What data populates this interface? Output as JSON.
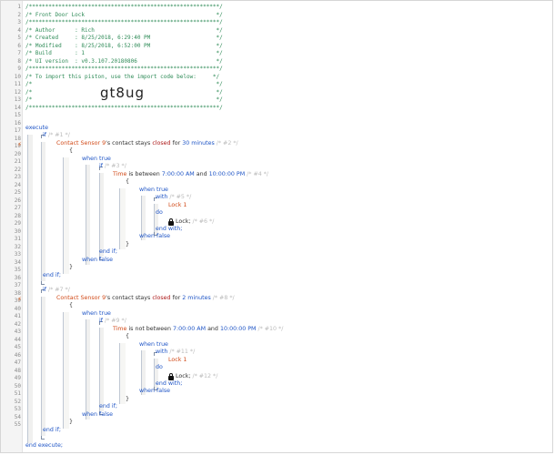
{
  "header": [
    "/**********************************************************/",
    "/* Front Door Lock                                        */",
    "/**********************************************************/",
    "/* Author      : Rich                                     */",
    "/* Created     : 8/25/2018, 6:29:40 PM                    */",
    "/* Modified    : 8/25/2018, 6:52:00 PM                    */",
    "/* Build       : 1                                        */",
    "/* UI version  : v0.3.107.20180806                        */",
    "/**********************************************************/",
    "/* To import this piston, use the import code below:     */",
    "/*                                                        */",
    "/*                                                        */",
    "/*                                                        */",
    "/**********************************************************/"
  ],
  "import_code": "gt8ug",
  "line_numbers": [
    "1",
    "2",
    "3",
    "4",
    "5",
    "6",
    "7",
    "8",
    "9",
    "10",
    "11",
    "12",
    "13",
    "14",
    "15",
    "16",
    "17",
    "18",
    "19",
    "20",
    "21",
    "22",
    "23",
    "24",
    "25",
    "26",
    "27",
    "28",
    "29",
    "30",
    "31",
    "32",
    "33",
    "34",
    "35",
    "36",
    "37",
    "38",
    "39",
    "40",
    "41",
    "42",
    "43",
    "44",
    "45",
    "46",
    "47",
    "48",
    "49",
    "50",
    "51",
    "52",
    "53",
    "54",
    "55"
  ],
  "trigger_mark": "⚡",
  "code": {
    "execute": "execute",
    "end_execute": "end execute;",
    "if_kw": "if",
    "end_if": "end if;",
    "brace_open": "{",
    "brace_close": "}",
    "when_true": "when true",
    "when_false": "when false",
    "with_kw": "with",
    "do_kw": "do",
    "end_with": "end with;",
    "blocks": [
      {
        "if_comment": "/* #1 */",
        "cond_device": "Contact Sensor 9",
        "cond_possessive": "'s contact",
        "cond_op": "stays",
        "cond_value": "closed",
        "cond_for": "for",
        "cond_duration": "30 minutes",
        "cond_comment": "/* #2 */",
        "inner_if_comment": "/* #3 */",
        "time_label": "Time",
        "time_op": "is between",
        "time_start": "7:00:00 AM",
        "time_and": "and",
        "time_end": "10:00:00 PM",
        "time_comment": "/* #4 */",
        "with_comment": "/* #5 */",
        "device": "Lock 1",
        "cmd": "Lock;",
        "cmd_comment": "/* #6 */"
      },
      {
        "if_comment": "/* #7 */",
        "cond_device": "Contact Sensor 9",
        "cond_possessive": "'s contact",
        "cond_op": "stays",
        "cond_value": "closed",
        "cond_for": "for",
        "cond_duration": "2 minutes",
        "cond_comment": "/* #8 */",
        "inner_if_comment": "/* #9 */",
        "time_label": "Time",
        "time_op": "is not between",
        "time_start": "7:00:00 AM",
        "time_and": "and",
        "time_end": "10:00:00 PM",
        "time_comment": "/* #10 */",
        "with_comment": "/* #11 */",
        "device": "Lock 1",
        "cmd": "Lock;",
        "cmd_comment": "/* #12 */"
      }
    ]
  }
}
